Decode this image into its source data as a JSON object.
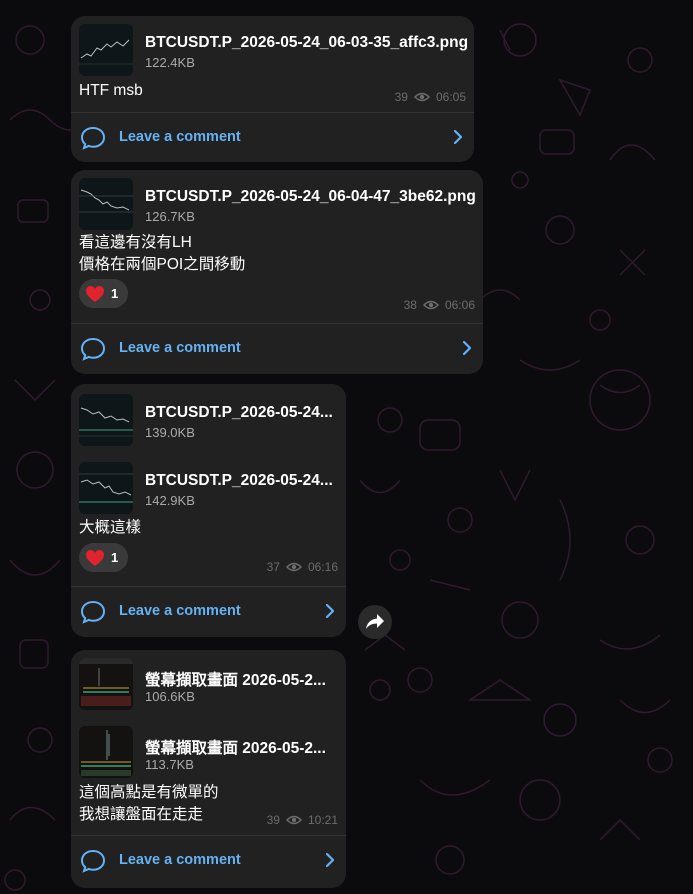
{
  "colors": {
    "background": "#0b0b0d",
    "bubble": "#212121",
    "accent_link": "#64b2f4",
    "meta_text": "#6d6d6d",
    "reaction_bg": "#3a3a3a"
  },
  "messages": [
    {
      "files": [
        {
          "name": "BTCUSDT.P_2026-05-24_06-03-35_affc3.png",
          "size": "122.4KB",
          "thumb": "chart-dark-thumbnail"
        }
      ],
      "caption": [
        "HTF msb"
      ],
      "reaction": null,
      "views": "39",
      "time": "06:05",
      "comment_label": "Leave a comment"
    },
    {
      "files": [
        {
          "name": "BTCUSDT.P_2026-05-24_06-04-47_3be62.png",
          "size": "126.7KB",
          "thumb": "chart-dark-thumbnail"
        }
      ],
      "caption": [
        "看這邊有沒有LH",
        "價格在兩個POI之間移動"
      ],
      "reaction": {
        "emoji": "heart",
        "count": "1"
      },
      "views": "38",
      "time": "06:06",
      "comment_label": "Leave a comment"
    },
    {
      "files": [
        {
          "name": "BTCUSDT.P_2026-05-24...",
          "size": "139.0KB",
          "thumb": "chart-dark-thumbnail"
        },
        {
          "name": "BTCUSDT.P_2026-05-24...",
          "size": "142.9KB",
          "thumb": "chart-dark-thumbnail"
        }
      ],
      "caption": [
        "大概這樣"
      ],
      "reaction": {
        "emoji": "heart",
        "count": "1"
      },
      "views": "37",
      "time": "06:16",
      "comment_label": "Leave a comment"
    },
    {
      "files": [
        {
          "name": "螢幕擷取畫面 2026-05-2...",
          "size": "106.6KB",
          "thumb": "screenshot-thumbnail"
        },
        {
          "name": "螢幕擷取畫面 2026-05-2...",
          "size": "113.7KB",
          "thumb": "screenshot-thumbnail"
        }
      ],
      "caption": [
        "這個高點是有微單的",
        "我想讓盤面在走走"
      ],
      "reaction": null,
      "views": "39",
      "time": "10:21",
      "comment_label": "Leave a comment"
    }
  ],
  "icons": {
    "view": "eye-icon",
    "comment": "comment-bubble-icon",
    "chevron": "chevron-right-icon",
    "forward": "forward-arrow-icon",
    "reaction": "red-heart-icon"
  }
}
